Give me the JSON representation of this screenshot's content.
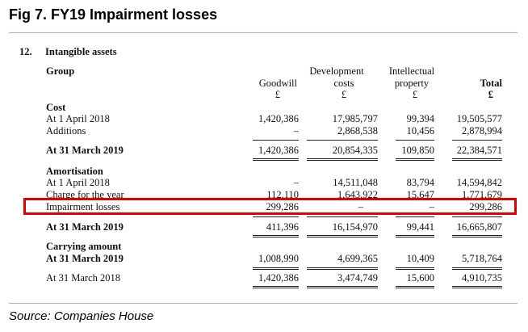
{
  "figure": {
    "title": "Fig 7. FY19 Impairment losses",
    "source": "Source: Companies House"
  },
  "note": {
    "number": "12.",
    "title": "Intangible assets"
  },
  "header": {
    "group": "Group",
    "goodwill": [
      "Goodwill",
      "£"
    ],
    "development": [
      "Development",
      "costs",
      "£"
    ],
    "intellectual": [
      "Intellectual",
      "property",
      "£"
    ],
    "total": [
      "Total",
      "£"
    ]
  },
  "rows": {
    "cost_heading": "Cost",
    "cost_open": {
      "label": "At 1 April 2018",
      "values": [
        "1,420,386",
        "17,985,797",
        "99,394",
        "19,505,577"
      ]
    },
    "additions": {
      "label": "Additions",
      "values": [
        "–",
        "2,868,538",
        "10,456",
        "2,878,994"
      ]
    },
    "cost_close": {
      "label": "At 31 March 2019",
      "values": [
        "1,420,386",
        "20,854,335",
        "109,850",
        "22,384,571"
      ]
    },
    "amort_heading": "Amortisation",
    "amort_open": {
      "label": "At 1 April 2018",
      "values": [
        "–",
        "14,511,048",
        "83,794",
        "14,594,842"
      ]
    },
    "charge": {
      "label": "Charge for the year",
      "values": [
        "112,110",
        "1,643,922",
        "15,647",
        "1,771,679"
      ]
    },
    "impairment": {
      "label": "Impairment losses",
      "values": [
        "299,286",
        "–",
        "–",
        "299,286"
      ]
    },
    "amort_close": {
      "label": "At 31 March 2019",
      "values": [
        "411,396",
        "16,154,970",
        "99,441",
        "16,665,807"
      ]
    },
    "carrying_heading": "Carrying amount",
    "carrying_2019": {
      "label": "At 31 March 2019",
      "values": [
        "1,008,990",
        "4,699,365",
        "10,409",
        "5,718,764"
      ]
    },
    "carrying_2018": {
      "label": "At 31 March 2018",
      "values": [
        "1,420,386",
        "3,474,749",
        "15,600",
        "4,910,735"
      ]
    }
  }
}
